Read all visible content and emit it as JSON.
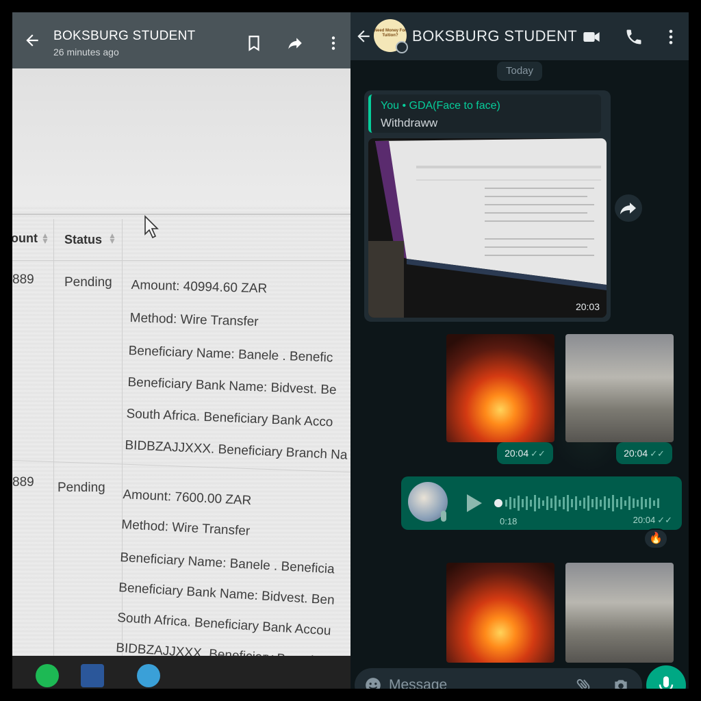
{
  "viewer": {
    "title": "BOKSBURG STUDENT",
    "subtitle": "26 minutes ago"
  },
  "photo_table": {
    "headers": [
      "ount",
      "Status"
    ],
    "rows": [
      {
        "id": "889",
        "status": "Pending",
        "lines": [
          "Amount: 40994.60 ZAR",
          "Method: Wire Transfer",
          "Beneficiary Name: Banele . Benefic",
          "Beneficiary Bank Name: Bidvest. Be",
          "South Africa. Beneficiary Bank Acco",
          "BIDBZAJJXXX. Beneficiary Branch Na"
        ]
      },
      {
        "id": "889",
        "status": "Pending",
        "lines": [
          "Amount: 7600.00 ZAR",
          "Method: Wire Transfer",
          "Beneficiary Name: Banele . Beneficia",
          "Beneficiary Bank Name: Bidvest. Ben",
          "South Africa. Beneficiary Bank Accou",
          "BIDBZAJJXXX. Beneficiary Branch Nam"
        ]
      }
    ]
  },
  "chat": {
    "title": "BOKSBURG STUDENT",
    "avatar_text": "Need Money For Tuition?",
    "day_label": "Today",
    "messages": {
      "image_reply": {
        "quote_author": "You • GDA(Face to face)",
        "quote_text": "Withdraww",
        "time": "20:03"
      },
      "media_row_1": {
        "time_a": "20:04",
        "time_b": "20:04"
      },
      "voice": {
        "duration": "0:18",
        "time": "20:04",
        "reaction": "🔥"
      }
    },
    "composer": {
      "placeholder": "Message"
    }
  },
  "colors": {
    "chat_header": "#202c33",
    "outgoing_bubble": "#005c4b",
    "accent": "#00a884",
    "quote_accent": "#06cf9c"
  },
  "icons": [
    "back-arrow-icon",
    "bookmark-icon",
    "share-icon",
    "more-vert-icon",
    "video-call-icon",
    "phone-icon",
    "forward-icon",
    "play-icon",
    "emoji-icon",
    "attach-icon",
    "camera-icon",
    "mic-icon",
    "double-check-icon"
  ]
}
